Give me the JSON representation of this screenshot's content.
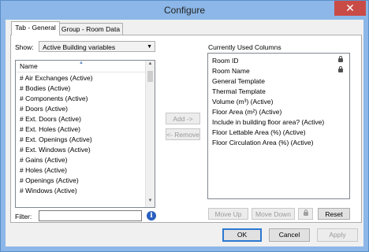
{
  "window": {
    "title": "Configure",
    "close_glyph": "✕"
  },
  "tabs": [
    {
      "label": "Tab - General",
      "active": true
    },
    {
      "label": "Group - Room Data",
      "active": false
    }
  ],
  "show": {
    "label": "Show:",
    "value": "Active Building variables"
  },
  "left_list": {
    "header": "Name",
    "items": [
      "# Air Exchanges (Active)",
      "# Bodies (Active)",
      "# Components (Active)",
      "# Doors (Active)",
      "# Ext. Doors (Active)",
      "# Ext. Holes (Active)",
      "# Ext. Openings (Active)",
      "# Ext. Windows (Active)",
      "# Gains (Active)",
      "# Holes (Active)",
      "# Openings (Active)",
      "# Windows (Active)"
    ]
  },
  "middle_buttons": {
    "add": "Add ->",
    "remove": "<- Remove"
  },
  "right_list": {
    "title": "Currently Used Columns",
    "items": [
      {
        "label": "Room ID",
        "locked": true
      },
      {
        "label": "Room Name",
        "locked": true
      },
      {
        "label": "General Template",
        "locked": false
      },
      {
        "label": "Thermal Template",
        "locked": false
      },
      {
        "label": "Volume (m³) (Active)",
        "locked": false
      },
      {
        "label": "Floor Area (m²) (Active)",
        "locked": false
      },
      {
        "label": "Include in building floor area? (Active)",
        "locked": false
      },
      {
        "label": "Floor Lettable Area (%) (Active)",
        "locked": false
      },
      {
        "label": "Floor Circulation Area (%) (Active)",
        "locked": false
      }
    ]
  },
  "filter": {
    "label": "Filter:",
    "value": "",
    "info_glyph": "i"
  },
  "right_buttons": {
    "move_up": "Move Up",
    "move_down": "Move Down",
    "reset": "Reset"
  },
  "footer": {
    "ok": "OK",
    "cancel": "Cancel",
    "apply": "Apply"
  }
}
